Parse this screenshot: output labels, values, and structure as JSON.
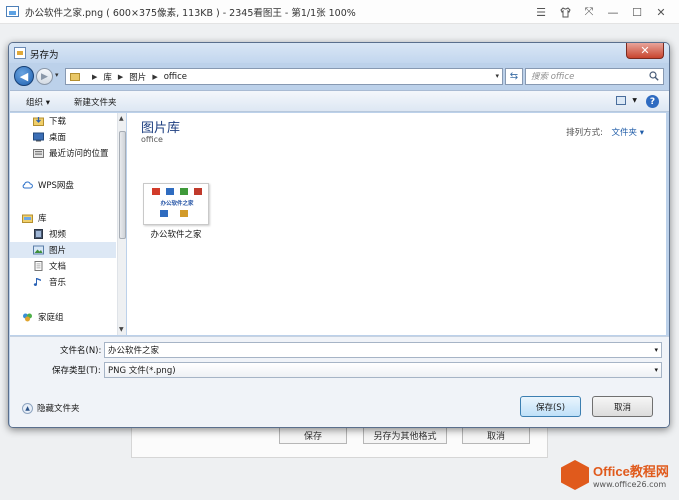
{
  "viewer": {
    "title": "办公软件之家.png ( 600×375像素, 113KB ) - 2345看图王 - 第1/1张 100%",
    "ctrl_icons": [
      "menu-icon",
      "skin-icon",
      "fullscreen-icon",
      "minimize-icon",
      "maximize-icon",
      "close-icon"
    ],
    "bg_buttons": {
      "save": "保存",
      "save_other": "另存为其他格式",
      "cancel": "取消"
    }
  },
  "dialog": {
    "title": "另存为",
    "close_glyph": "✕",
    "breadcrumb": [
      "库",
      "图片",
      "office"
    ],
    "search_placeholder": "搜索 office",
    "toolbar": {
      "organize": "组织 ▾",
      "new_folder": "新建文件夹",
      "help": "?"
    },
    "nav_items": [
      {
        "label": "下载",
        "icon": "download-folder-icon",
        "selected": false
      },
      {
        "label": "桌面",
        "icon": "desktop-icon",
        "selected": false
      },
      {
        "label": "最近访问的位置",
        "icon": "recent-places-icon",
        "selected": false
      },
      {
        "label": "WPS网盘",
        "icon": "wps-cloud-icon",
        "selected": false
      },
      {
        "label": "库",
        "icon": "library-icon",
        "selected": false
      },
      {
        "label": "视频",
        "icon": "video-icon",
        "selected": false
      },
      {
        "label": "图片",
        "icon": "pictures-icon",
        "selected": true
      },
      {
        "label": "文档",
        "icon": "documents-icon",
        "selected": false
      },
      {
        "label": "音乐",
        "icon": "music-icon",
        "selected": false
      },
      {
        "label": "家庭组",
        "icon": "homegroup-icon",
        "selected": false
      }
    ],
    "library": {
      "title": "图片库",
      "subtitle": "office",
      "arrange_label": "排列方式:",
      "arrange_value": "文件夹 ▾"
    },
    "files": [
      {
        "name": "办公软件之家",
        "thumb_text": "办公软件之家"
      }
    ],
    "filename_label": "文件名(N):",
    "filename_value": "办公软件之家",
    "filetype_label": "保存类型(T):",
    "filetype_value": "PNG 文件(*.png)",
    "hide_folders": "隐藏文件夹",
    "save_button": "保存(S)",
    "cancel_button": "取消"
  },
  "watermark": {
    "main": "Office教程网",
    "url": "www.office26.com"
  },
  "colors": {
    "accent": "#1e3f80",
    "close": "#c8452f",
    "brand": "#e05a1c"
  }
}
